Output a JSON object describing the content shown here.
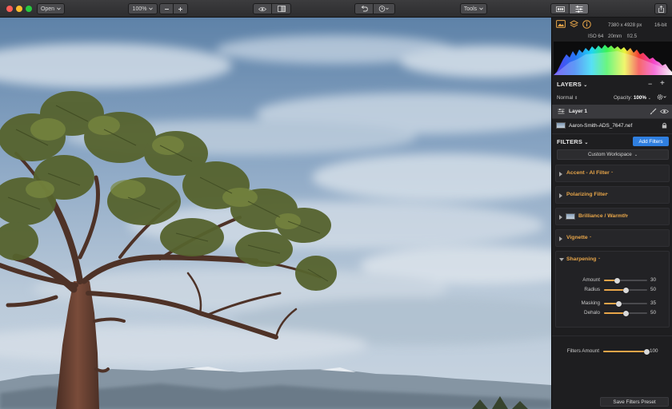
{
  "toolbar": {
    "open_label": "Open",
    "zoom_label": "100%",
    "tools_label": "Tools"
  },
  "panel": {
    "image_dims": "7380 x 4928 px",
    "bit_depth": "16-bit",
    "iso": "ISO 64",
    "focal": "20mm",
    "aperture": "f/2.5",
    "layers": {
      "title": "LAYERS",
      "blend_mode": "Normal",
      "opacity_label": "Opacity:",
      "opacity_value": "100%",
      "layer1_name": "Layer 1",
      "image_file": "Aaron-Smith-ADS_7647.nef"
    },
    "filters": {
      "title": "FILTERS",
      "add_button": "Add Filters",
      "workspace": "Custom Workspace",
      "items": [
        {
          "label": "Accent - AI Filter"
        },
        {
          "label": "Polarizing Filter"
        },
        {
          "label": "Brilliance / Warmth"
        },
        {
          "label": "Vignette"
        },
        {
          "label": "Sharpening"
        }
      ],
      "sharpening_sliders": [
        {
          "label": "Amount",
          "value": "30",
          "fraction": 0.3
        },
        {
          "label": "Radius",
          "value": "50",
          "fraction": 0.5
        },
        {
          "label": "Masking",
          "value": "35",
          "fraction": 0.35
        },
        {
          "label": "Dehalo",
          "value": "50",
          "fraction": 0.5
        }
      ],
      "filters_amount": {
        "label": "Filters Amount",
        "value": "100",
        "fraction": 1.0
      },
      "save_preset": "Save Filters Preset"
    }
  },
  "colors": {
    "accent_orange": "#e7a549",
    "accent_blue": "#2f7fe0"
  }
}
